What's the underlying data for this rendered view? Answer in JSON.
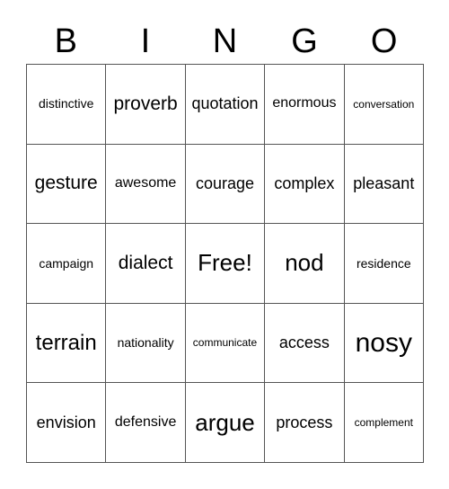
{
  "card": {
    "title": "BINGO",
    "header_letters": [
      "B",
      "I",
      "N",
      "G",
      "O"
    ],
    "free_space_label": "Free!",
    "colors": {
      "background": "#ffffff",
      "text": "#000000",
      "border": "#555555"
    },
    "rows": [
      [
        {
          "text": "distinctive",
          "size": "sm"
        },
        {
          "text": "proverb",
          "size": "xl"
        },
        {
          "text": "quotation",
          "size": "lg"
        },
        {
          "text": "enormous",
          "size": "md"
        },
        {
          "text": "conversation",
          "size": "xs"
        }
      ],
      [
        {
          "text": "gesture",
          "size": "xl"
        },
        {
          "text": "awesome",
          "size": "md"
        },
        {
          "text": "courage",
          "size": "lg"
        },
        {
          "text": "complex",
          "size": "lg"
        },
        {
          "text": "pleasant",
          "size": "lg"
        }
      ],
      [
        {
          "text": "campaign",
          "size": "sm"
        },
        {
          "text": "dialect",
          "size": "xl"
        },
        {
          "text": "Free!",
          "size": "3xl"
        },
        {
          "text": "nod",
          "size": "3xl"
        },
        {
          "text": "residence",
          "size": "sm"
        }
      ],
      [
        {
          "text": "terrain",
          "size": "2xl"
        },
        {
          "text": "nationality",
          "size": "sm"
        },
        {
          "text": "communicate",
          "size": "xs"
        },
        {
          "text": "access",
          "size": "lg"
        },
        {
          "text": "nosy",
          "size": "4xl"
        }
      ],
      [
        {
          "text": "envision",
          "size": "lg"
        },
        {
          "text": "defensive",
          "size": "md"
        },
        {
          "text": "argue",
          "size": "3xl"
        },
        {
          "text": "process",
          "size": "lg"
        },
        {
          "text": "complement",
          "size": "xs"
        }
      ]
    ]
  }
}
